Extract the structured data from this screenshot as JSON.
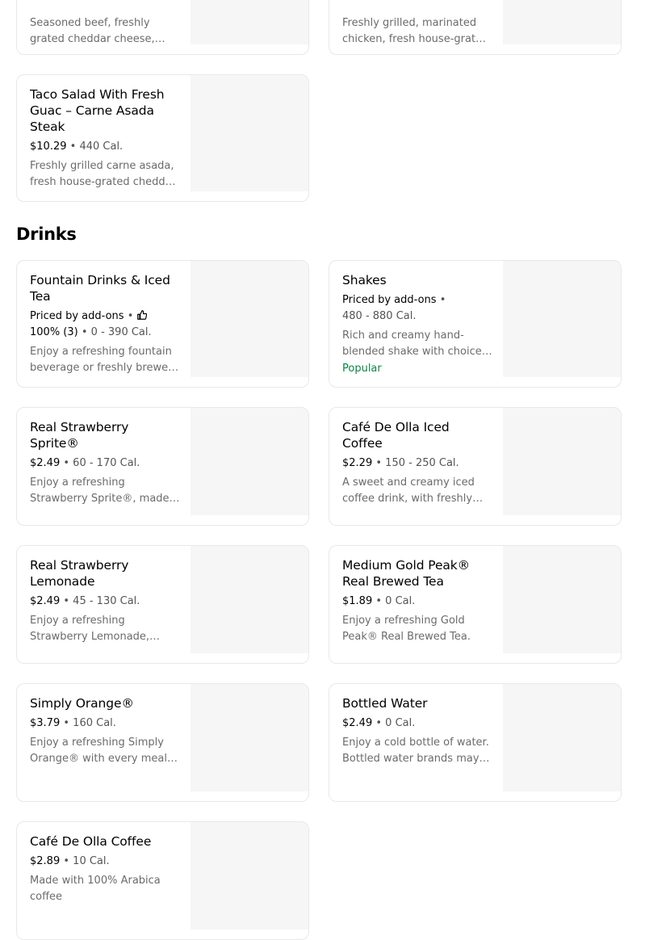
{
  "top_items": [
    {
      "description": "Seasoned beef, freshly grated cheddar cheese, fresh lettuce"
    },
    {
      "description": "Freshly grilled, marinated chicken, fresh house-grated cheddar"
    },
    {
      "title": "Taco Salad With Fresh Guac – Carne Asada Steak",
      "price": "$10.29",
      "calories": "440 Cal.",
      "description": "Freshly grilled carne asada, fresh house-grated cheddar cheese"
    }
  ],
  "section": {
    "title": "Drinks"
  },
  "drinks": [
    {
      "title": "Fountain Drinks & Iced Tea",
      "priced_by": "Priced by add-ons",
      "rating": "100% (3)",
      "calories": "0 - 390 Cal.",
      "description": "Enjoy a refreshing fountain beverage or freshly brewed iced tea"
    },
    {
      "title": "Shakes",
      "priced_by": "Priced by add-ons",
      "calories": "480 - 880 Cal.",
      "description": "Rich and creamy hand-blended shake with choice of flavor",
      "badge": "Popular"
    },
    {
      "title": "Real Strawberry Sprite®",
      "price": "$2.49",
      "calories": "60 - 170 Cal.",
      "description": "Enjoy a refreshing Strawberry Sprite®, made with real strawberries"
    },
    {
      "title": "Café De Olla Iced Coffee",
      "price": "$2.29",
      "calories": "150 - 250 Cal.",
      "description": "A sweet and creamy iced coffee drink, with freshly brewed coffee"
    },
    {
      "title": "Real Strawberry Lemonade",
      "price": "$2.49",
      "calories": "45 - 130 Cal.",
      "description": "Enjoy a refreshing Strawberry Lemonade, made with real strawberries"
    },
    {
      "title": "Medium Gold Peak® Real Brewed Tea",
      "price": "$1.89",
      "calories": "0 Cal.",
      "description": "Enjoy a refreshing Gold Peak® Real Brewed Tea."
    },
    {
      "title": "Simply Orange®",
      "price": "$3.79",
      "calories": "160 Cal.",
      "description": "Enjoy a refreshing Simply Orange® with every meal of the day"
    },
    {
      "title": "Bottled Water",
      "price": "$2.49",
      "calories": "0 Cal.",
      "description": "Enjoy a cold bottle of water. Bottled water brands may vary"
    },
    {
      "title": "Café De Olla Coffee",
      "price": "$2.89",
      "calories": "10 Cal.",
      "description": "Made with 100% Arabica coffee"
    }
  ],
  "separator": "•",
  "icons": {
    "rating": "thumbs-up-icon"
  },
  "colors": {
    "popular": "#0e8345",
    "card_border": "#e8e8e8",
    "image_placeholder": "#f6f6f6",
    "secondary_text": "#545454"
  }
}
